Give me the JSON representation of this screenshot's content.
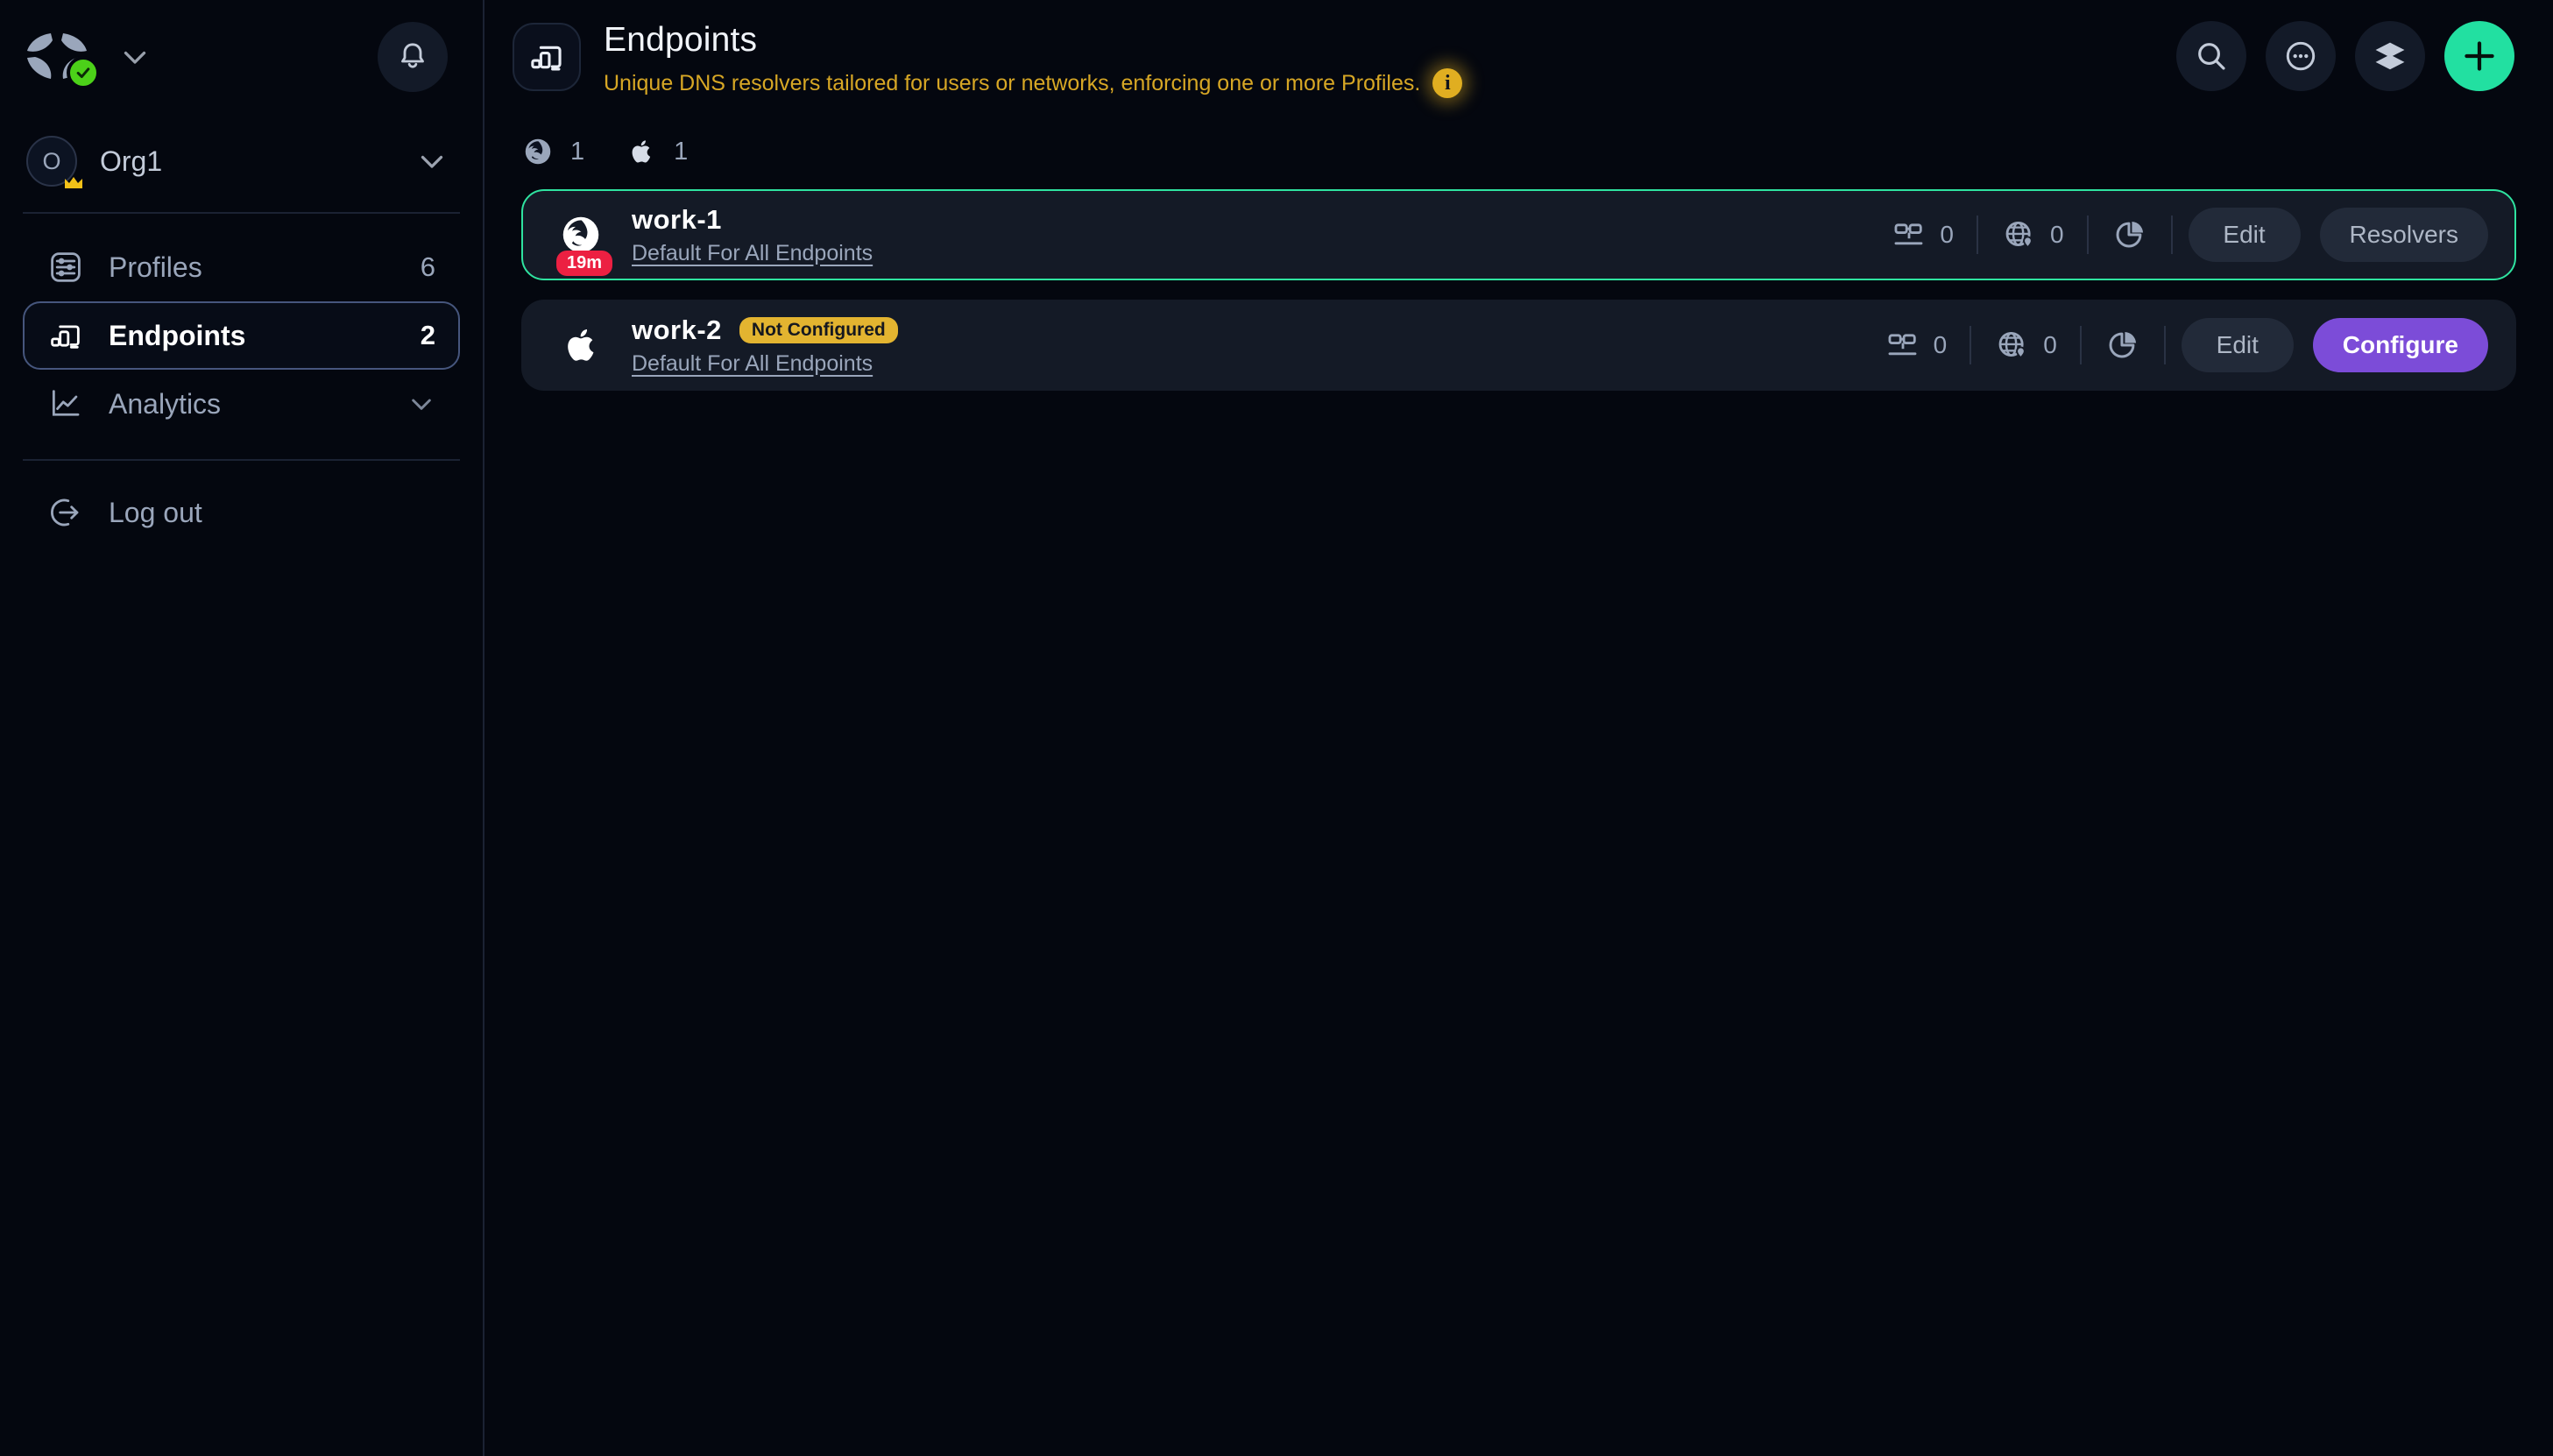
{
  "sidebar": {
    "logo": {
      "icon": "clover-logo-icon",
      "status_icon": "check-badge-icon"
    },
    "brand_dropdown_icon": "chevron-down-icon",
    "notifications_icon": "bell-icon",
    "org": {
      "avatar_letter": "O",
      "name": "Org1",
      "badge_icon": "crown-icon",
      "chevron_icon": "chevron-down-icon"
    },
    "items": [
      {
        "id": "profiles",
        "label": "Profiles",
        "count": "6",
        "icon": "sliders-icon",
        "active": false,
        "has_chevron": false
      },
      {
        "id": "endpoints",
        "label": "Endpoints",
        "count": "2",
        "icon": "devices-icon",
        "active": true,
        "has_chevron": false
      },
      {
        "id": "analytics",
        "label": "Analytics",
        "count": "",
        "icon": "line-chart-icon",
        "active": false,
        "has_chevron": true
      }
    ],
    "logout": {
      "label": "Log out",
      "icon": "logout-icon"
    }
  },
  "header": {
    "icon": "devices-icon",
    "title": "Endpoints",
    "subtitle": "Unique DNS resolvers tailored for users or networks, enforcing one or more Profiles.",
    "info_glyph": "i",
    "info_icon": "info-icon",
    "actions": [
      {
        "id": "search",
        "icon": "search-icon"
      },
      {
        "id": "more",
        "icon": "more-circle-icon"
      },
      {
        "id": "layers",
        "icon": "layers-icon"
      },
      {
        "id": "add",
        "icon": "plus-icon"
      }
    ]
  },
  "filters": [
    {
      "id": "firefox",
      "icon": "firefox-icon",
      "count": "1"
    },
    {
      "id": "apple",
      "icon": "apple-icon",
      "count": "1"
    }
  ],
  "endpoints": [
    {
      "id": "work-1",
      "platform_icon": "firefox-icon",
      "name": "work-1",
      "time_badge": "19m",
      "status_pill": "",
      "profile": "Default For All Endpoints",
      "selected": true,
      "stats": [
        {
          "id": "devices",
          "icon": "devices-network-icon",
          "value": "0"
        },
        {
          "id": "domains",
          "icon": "globe-pin-icon",
          "value": "0"
        },
        {
          "id": "analytics",
          "icon": "pie-chart-icon",
          "value": ""
        }
      ],
      "buttons": [
        {
          "id": "edit",
          "label": "Edit",
          "style": "ghost"
        },
        {
          "id": "resolvers",
          "label": "Resolvers",
          "style": "ghost"
        }
      ]
    },
    {
      "id": "work-2",
      "platform_icon": "apple-icon",
      "name": "work-2",
      "time_badge": "",
      "status_pill": "Not Configured",
      "profile": "Default For All Endpoints",
      "selected": false,
      "stats": [
        {
          "id": "devices",
          "icon": "devices-network-icon",
          "value": "0"
        },
        {
          "id": "domains",
          "icon": "globe-pin-icon",
          "value": "0"
        },
        {
          "id": "analytics",
          "icon": "pie-chart-icon",
          "value": ""
        }
      ],
      "buttons": [
        {
          "id": "edit",
          "label": "Edit",
          "style": "ghost"
        },
        {
          "id": "configure",
          "label": "Configure",
          "style": "primary"
        }
      ]
    }
  ],
  "colors": {
    "page_bg": "#04070f",
    "row_bg": "#141a26",
    "accent_green": "#22e0a1",
    "selected_border": "#2fe3a0",
    "amber": "#d7a725",
    "pill_amber": "#e3b430",
    "badge_red": "#ec2042",
    "primary_purple": "#7c4cd8",
    "text_muted": "#9aa6bb",
    "active_border": "#46567d"
  }
}
